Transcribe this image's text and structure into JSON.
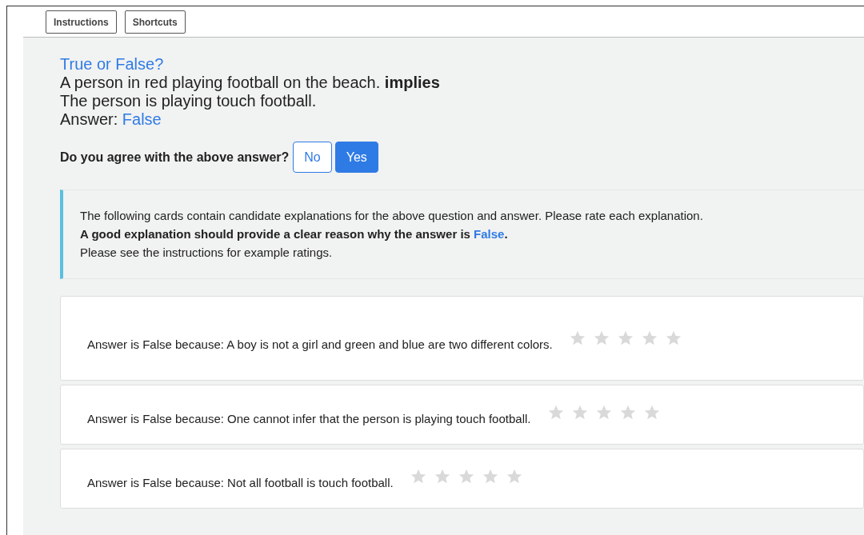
{
  "toolbar": [
    {
      "label": "Instructions"
    },
    {
      "label": "Shortcuts"
    }
  ],
  "question": {
    "title": "True or False?",
    "premise": "A person in red playing football on the beach.",
    "connective": "implies",
    "hypothesis": "The person is playing touch football.",
    "answer_label": "Answer:",
    "answer": "False"
  },
  "agree": {
    "prompt": "Do you agree with the above answer?",
    "options": [
      {
        "label": "No",
        "selected": false
      },
      {
        "label": "Yes",
        "selected": true
      }
    ]
  },
  "notice": {
    "line_1": "The following cards contain candidate explanations for the above question and answer. Please rate each explanation.",
    "line_2": "A good explanation should provide a clear reason why the answer is",
    "line_2_highlight": "False",
    "line_2_end": ".",
    "line_3": "Please see the instructions for example ratings."
  },
  "explanations": [
    {
      "text": "Answer is False because: A boy is not a girl and green and blue are two different colors.",
      "stars": 0
    },
    {
      "text": "Answer is False because: One cannot infer that the person is playing touch football.",
      "stars": 0
    },
    {
      "text": "Answer is False because: Not all football is touch football.",
      "stars": 0
    }
  ]
}
